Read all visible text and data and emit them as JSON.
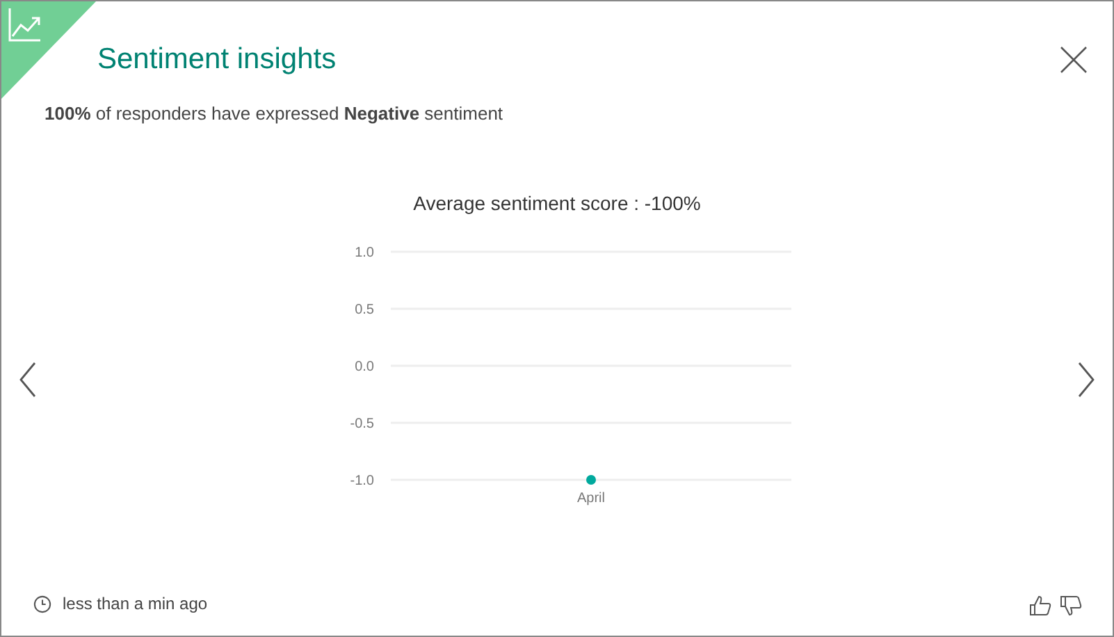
{
  "dialog": {
    "title": "Sentiment insights",
    "summary": "**100%** of responders have expressed **Negative** sentiment"
  },
  "chart": {
    "chart_data": {
      "type": "scatter",
      "title": "Average sentiment score : -100%",
      "categories": [
        "April"
      ],
      "series": [
        {
          "color": "#00a99d",
          "values": [
            -1.0
          ]
        }
      ],
      "grid": true,
      "ylim": [
        -1.0,
        1.0
      ],
      "yticks": [
        {
          "value": 1.0,
          "label": "1.0"
        },
        {
          "value": 0.5,
          "label": "0.5"
        },
        {
          "value": 0.0,
          "label": "0.0"
        },
        {
          "value": -0.5,
          "label": "-0.5"
        },
        {
          "value": -1.0,
          "label": "-1.0"
        }
      ]
    }
  },
  "footer": {
    "timestamp": "less than a min ago"
  }
}
